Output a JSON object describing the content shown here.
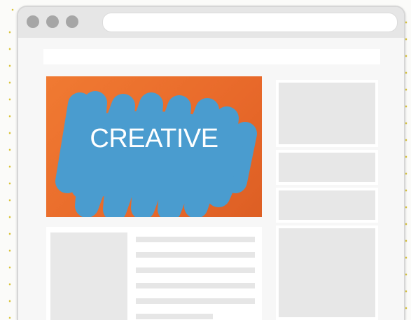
{
  "hero": {
    "label": "CREATIVE"
  },
  "colors": {
    "hero_background": "#e8692a",
    "scribble": "#4a9ccf",
    "window_chrome": "#e6e6e6",
    "placeholder": "#e7e7e7",
    "guide_dots": "#d9c43a"
  },
  "icons": [
    "traffic-light-dot",
    "traffic-light-dot",
    "traffic-light-dot"
  ]
}
